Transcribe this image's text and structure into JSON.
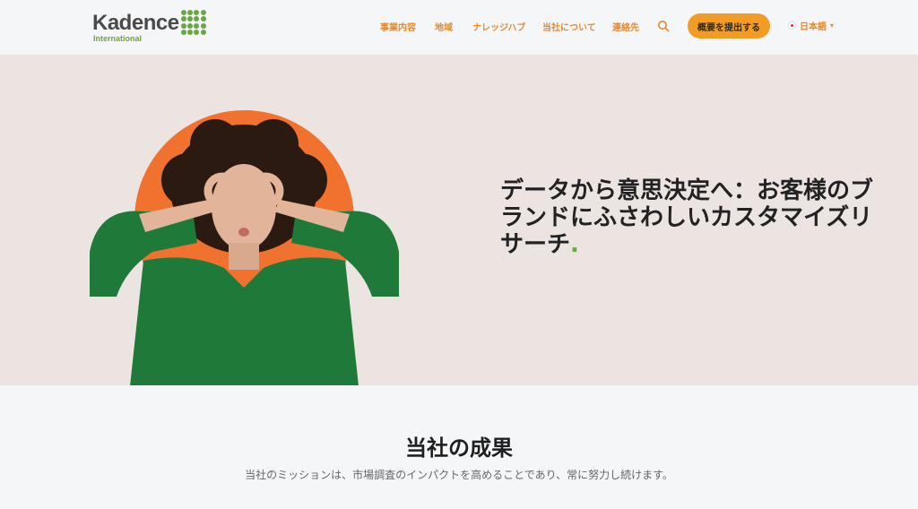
{
  "header": {
    "logo_word": "Kadence",
    "logo_sub": "International",
    "nav": [
      {
        "label": "事業内容"
      },
      {
        "label": "地域"
      },
      {
        "label": "ナレッジハブ"
      },
      {
        "label": "当社について"
      },
      {
        "label": "連絡先"
      }
    ],
    "cta_label": "概要を提出する",
    "language": "日本語",
    "search_icon": "search-icon"
  },
  "hero": {
    "title": "データから意思決定へ：お客様のブランドにふさわしいカスタマイズリサーチ",
    "title_dot": ".",
    "accent_color": "#f1712f",
    "background": "#ece4e1"
  },
  "results": {
    "title": "当社の成果",
    "subtitle": "当社のミッションは、市場調査のインパクトを高めることであり、常に努力し続けます。"
  },
  "colors": {
    "brand_green": "#6aa843",
    "nav_orange": "#e8892b",
    "cta_orange": "#f39c25"
  }
}
